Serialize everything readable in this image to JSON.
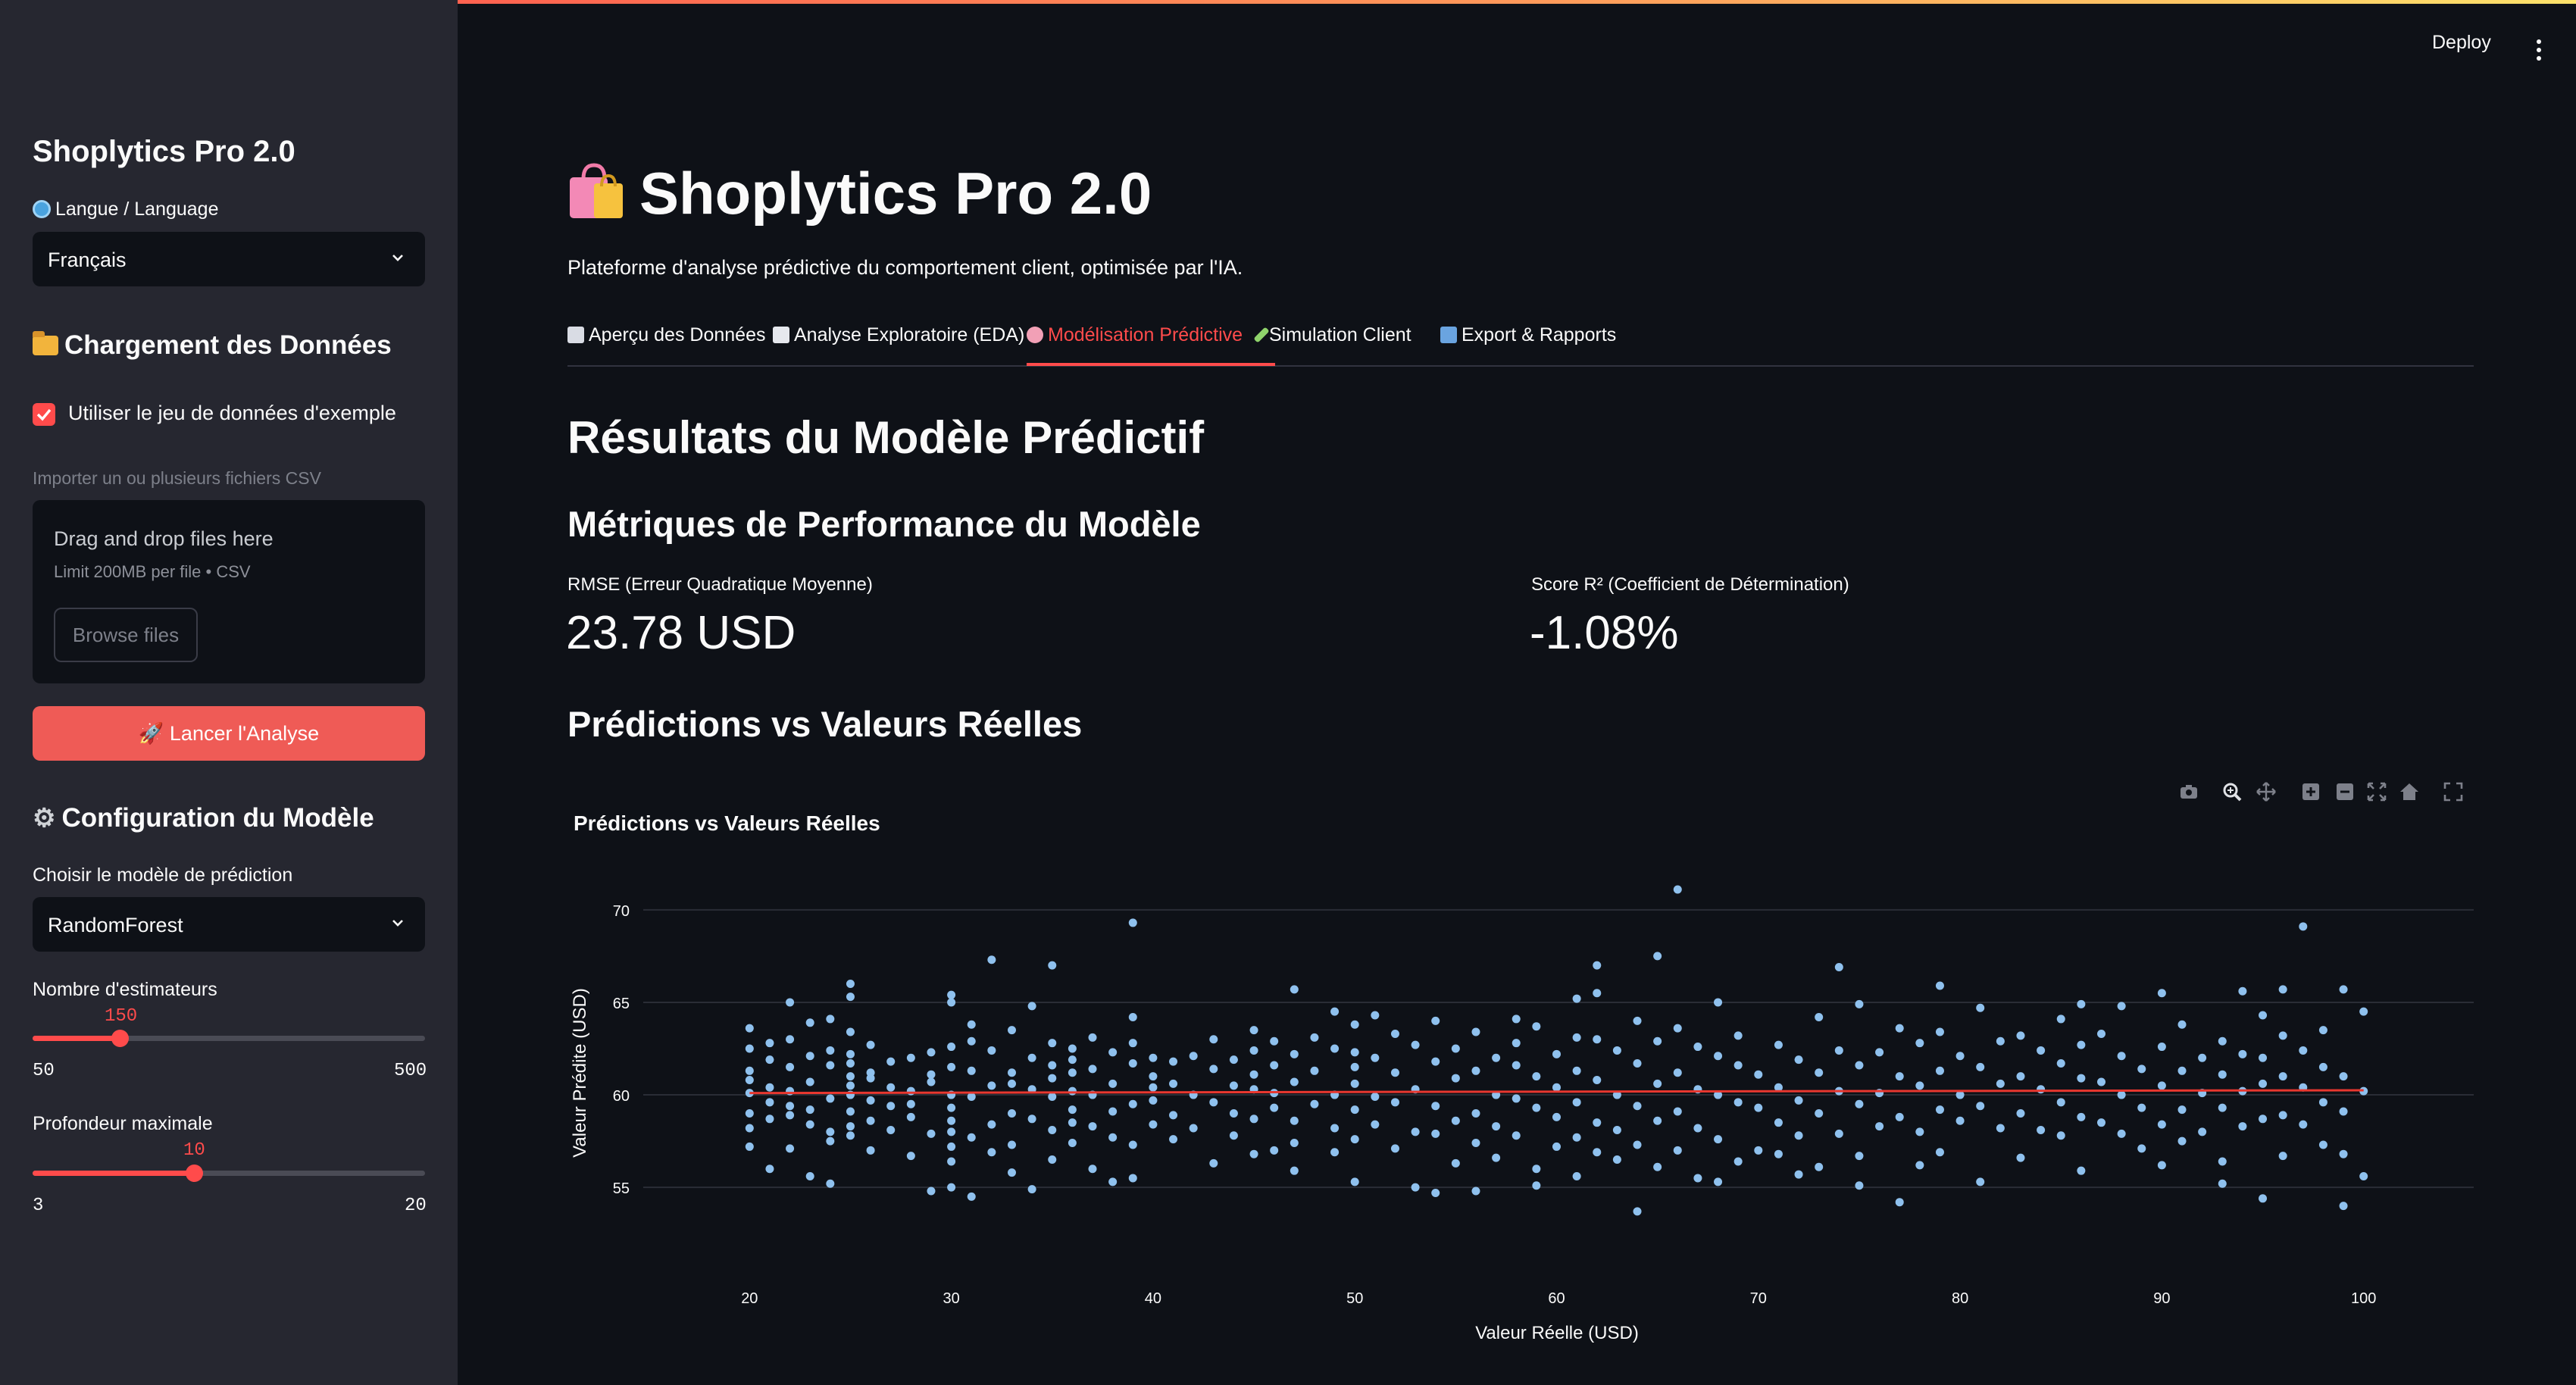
{
  "app": {
    "deploy_label": "Deploy"
  },
  "sidebar": {
    "title": "Shoplytics Pro 2.0",
    "language_label": "Langue / Language",
    "language_value": "Français",
    "data_section_title": "Chargement des Données",
    "use_example_label": "Utiliser le jeu de données d'exemple",
    "use_example_checked": true,
    "import_label": "Importer un ou plusieurs fichiers CSV",
    "uploader": {
      "drag_text": "Drag and drop files here",
      "limit_text": "Limit 200MB per file • CSV",
      "browse_label": "Browse files"
    },
    "launch_label": "🚀 Lancer l'Analyse",
    "model_section_title": "Configuration du Modèle",
    "model_choice_label": "Choisir le modèle de prédiction",
    "model_choice_value": "RandomForest",
    "estimators": {
      "label": "Nombre d'estimateurs",
      "value": "150",
      "min": "50",
      "max": "500",
      "fraction": 0.2222
    },
    "depth": {
      "label": "Profondeur maximale",
      "value": "10",
      "min": "3",
      "max": "20",
      "fraction": 0.4118
    }
  },
  "main": {
    "title": "Shoplytics Pro 2.0",
    "subtitle": "Plateforme d'analyse prédictive du comportement client, optimisée par l'IA.",
    "tabs": [
      {
        "label": "Aperçu des Données",
        "icon": "bar-chart-icon",
        "active": false
      },
      {
        "label": "Analyse Exploratoire (EDA)",
        "icon": "trend-chart-icon",
        "active": false
      },
      {
        "label": "Modélisation Prédictive",
        "icon": "brain-icon",
        "active": true
      },
      {
        "label": "Simulation Client",
        "icon": "syringe-icon",
        "active": false
      },
      {
        "label": "Export & Rapports",
        "icon": "outbox-tray-icon",
        "active": false
      }
    ],
    "results_title": "Résultats du Modèle Prédictif",
    "metrics_title": "Métriques de Performance du Modèle",
    "metrics": [
      {
        "label": "RMSE (Erreur Quadratique Moyenne)",
        "value": "23.78 USD"
      },
      {
        "label": "Score R² (Coefficient de Détermination)",
        "value": "-1.08%"
      }
    ],
    "pred_section_title": "Prédictions vs Valeurs Réelles"
  },
  "colors": {
    "accent": "#ff4b4b",
    "points": "#8fc1ee",
    "fit_line": "#e8372f",
    "background": "#0e1117",
    "sidebar": "#262730"
  },
  "chart_data": {
    "type": "scatter",
    "title": "Prédictions vs Valeurs Réelles",
    "xlabel": "Valeur Réelle (USD)",
    "ylabel": "Valeur Prédite (USD)",
    "xlim": [
      19.5,
      100.5
    ],
    "ylim": [
      53,
      72
    ],
    "x_ticks": [
      20,
      30,
      40,
      50,
      60,
      70,
      80,
      90,
      100
    ],
    "y_ticks": [
      55,
      60,
      65,
      70
    ],
    "grid": true,
    "legend": "none",
    "fit_line": {
      "x": [
        20,
        100
      ],
      "y": [
        60.1,
        60.25
      ]
    },
    "points": [
      [
        20,
        60.1
      ],
      [
        20,
        62.5
      ],
      [
        20,
        58.2
      ],
      [
        20,
        61.3
      ],
      [
        20,
        59.0
      ],
      [
        20,
        63.6
      ],
      [
        20,
        57.2
      ],
      [
        20,
        60.8
      ],
      [
        21,
        59.6
      ],
      [
        21,
        61.9
      ],
      [
        21,
        58.7
      ],
      [
        21,
        62.8
      ],
      [
        21,
        56.0
      ],
      [
        21,
        60.4
      ],
      [
        22,
        65.0
      ],
      [
        22,
        60.2
      ],
      [
        22,
        58.9
      ],
      [
        22,
        61.5
      ],
      [
        22,
        57.1
      ],
      [
        22,
        63.0
      ],
      [
        22,
        59.4
      ],
      [
        23,
        62.1
      ],
      [
        23,
        58.4
      ],
      [
        23,
        55.6
      ],
      [
        23,
        60.7
      ],
      [
        23,
        63.9
      ],
      [
        23,
        59.2
      ],
      [
        24,
        59.8
      ],
      [
        24,
        61.6
      ],
      [
        24,
        55.2
      ],
      [
        24,
        58.0
      ],
      [
        24,
        62.4
      ],
      [
        24,
        64.1
      ],
      [
        24,
        57.5
      ],
      [
        25,
        66.0
      ],
      [
        25,
        65.3
      ],
      [
        25,
        61.0
      ],
      [
        25,
        60.0
      ],
      [
        25,
        59.1
      ],
      [
        25,
        58.3
      ],
      [
        25,
        62.2
      ],
      [
        25,
        57.8
      ],
      [
        25,
        63.4
      ],
      [
        25,
        61.7
      ],
      [
        25,
        60.5
      ],
      [
        26,
        58.6
      ],
      [
        26,
        60.9
      ],
      [
        26,
        62.7
      ],
      [
        26,
        59.7
      ],
      [
        26,
        61.2
      ],
      [
        26,
        57.0
      ],
      [
        27,
        60.4
      ],
      [
        27,
        58.1
      ],
      [
        27,
        61.8
      ],
      [
        27,
        59.4
      ],
      [
        28,
        56.7
      ],
      [
        28,
        60.2
      ],
      [
        28,
        58.8
      ],
      [
        28,
        62.0
      ],
      [
        28,
        59.5
      ],
      [
        29,
        54.8
      ],
      [
        29,
        57.9
      ],
      [
        29,
        60.7
      ],
      [
        29,
        62.3
      ],
      [
        29,
        61.1
      ],
      [
        30,
        65.4
      ],
      [
        30,
        65.0
      ],
      [
        30,
        61.5
      ],
      [
        30,
        60.0
      ],
      [
        30,
        58.6
      ],
      [
        30,
        57.2
      ],
      [
        30,
        55.0
      ],
      [
        30,
        59.3
      ],
      [
        30,
        62.6
      ],
      [
        30,
        58.0
      ],
      [
        30,
        56.4
      ],
      [
        31,
        59.9
      ],
      [
        31,
        61.3
      ],
      [
        31,
        57.7
      ],
      [
        31,
        54.5
      ],
      [
        31,
        62.9
      ],
      [
        31,
        63.8
      ],
      [
        32,
        67.3
      ],
      [
        32,
        60.5
      ],
      [
        32,
        58.4
      ],
      [
        32,
        62.4
      ],
      [
        32,
        56.9
      ],
      [
        33,
        63.5
      ],
      [
        33,
        61.2
      ],
      [
        33,
        59.0
      ],
      [
        33,
        57.3
      ],
      [
        33,
        55.8
      ],
      [
        33,
        60.6
      ],
      [
        34,
        64.8
      ],
      [
        34,
        62.0
      ],
      [
        34,
        60.3
      ],
      [
        34,
        58.7
      ],
      [
        34,
        54.9
      ],
      [
        35,
        67.0
      ],
      [
        35,
        62.8
      ],
      [
        35,
        61.6
      ],
      [
        35,
        59.9
      ],
      [
        35,
        58.1
      ],
      [
        35,
        56.5
      ],
      [
        35,
        60.9
      ],
      [
        36,
        61.2
      ],
      [
        36,
        59.2
      ],
      [
        36,
        57.4
      ],
      [
        36,
        62.5
      ],
      [
        36,
        60.2
      ],
      [
        36,
        58.5
      ],
      [
        36,
        61.9
      ],
      [
        37,
        63.1
      ],
      [
        37,
        60.0
      ],
      [
        37,
        58.3
      ],
      [
        37,
        56.0
      ],
      [
        37,
        61.4
      ],
      [
        38,
        62.3
      ],
      [
        38,
        60.6
      ],
      [
        38,
        59.1
      ],
      [
        38,
        57.7
      ],
      [
        38,
        55.3
      ],
      [
        39,
        69.3
      ],
      [
        39,
        64.2
      ],
      [
        39,
        61.7
      ],
      [
        39,
        59.5
      ],
      [
        39,
        57.3
      ],
      [
        39,
        55.5
      ],
      [
        39,
        62.8
      ],
      [
        40,
        61.0
      ],
      [
        40,
        59.7
      ],
      [
        40,
        58.4
      ],
      [
        40,
        62.0
      ],
      [
        40,
        60.4
      ],
      [
        41,
        60.6
      ],
      [
        41,
        58.9
      ],
      [
        41,
        61.8
      ],
      [
        41,
        57.6
      ],
      [
        42,
        62.1
      ],
      [
        42,
        60.0
      ],
      [
        42,
        58.2
      ],
      [
        43,
        59.6
      ],
      [
        43,
        61.4
      ],
      [
        43,
        56.3
      ],
      [
        43,
        63.0
      ],
      [
        44,
        61.9
      ],
      [
        44,
        59.0
      ],
      [
        44,
        57.8
      ],
      [
        44,
        60.5
      ],
      [
        45,
        62.4
      ],
      [
        45,
        60.3
      ],
      [
        45,
        58.7
      ],
      [
        45,
        56.8
      ],
      [
        45,
        61.1
      ],
      [
        45,
        63.5
      ],
      [
        46,
        61.6
      ],
      [
        46,
        59.3
      ],
      [
        46,
        57.0
      ],
      [
        46,
        62.9
      ],
      [
        46,
        60.1
      ],
      [
        47,
        65.7
      ],
      [
        47,
        62.2
      ],
      [
        47,
        60.7
      ],
      [
        47,
        58.6
      ],
      [
        47,
        57.4
      ],
      [
        47,
        55.9
      ],
      [
        48,
        61.3
      ],
      [
        48,
        59.5
      ],
      [
        48,
        63.1
      ],
      [
        49,
        64.5
      ],
      [
        49,
        62.5
      ],
      [
        49,
        60.0
      ],
      [
        49,
        58.2
      ],
      [
        49,
        56.9
      ],
      [
        50,
        63.8
      ],
      [
        50,
        61.5
      ],
      [
        50,
        59.2
      ],
      [
        50,
        57.6
      ],
      [
        50,
        55.3
      ],
      [
        50,
        62.3
      ],
      [
        50,
        60.6
      ],
      [
        51,
        64.3
      ],
      [
        51,
        62.0
      ],
      [
        51,
        59.9
      ],
      [
        51,
        58.4
      ],
      [
        52,
        63.3
      ],
      [
        52,
        61.2
      ],
      [
        52,
        59.6
      ],
      [
        52,
        57.1
      ],
      [
        53,
        62.7
      ],
      [
        53,
        60.3
      ],
      [
        53,
        58.0
      ],
      [
        53,
        55.0
      ],
      [
        54,
        64.0
      ],
      [
        54,
        61.8
      ],
      [
        54,
        59.4
      ],
      [
        54,
        57.9
      ],
      [
        54,
        54.7
      ],
      [
        55,
        62.5
      ],
      [
        55,
        60.9
      ],
      [
        55,
        58.6
      ],
      [
        55,
        56.3
      ],
      [
        56,
        63.4
      ],
      [
        56,
        61.3
      ],
      [
        56,
        59.0
      ],
      [
        56,
        57.4
      ],
      [
        56,
        54.8
      ],
      [
        57,
        62.0
      ],
      [
        57,
        60.0
      ],
      [
        57,
        58.3
      ],
      [
        57,
        56.6
      ],
      [
        58,
        64.1
      ],
      [
        58,
        61.6
      ],
      [
        58,
        59.8
      ],
      [
        58,
        57.8
      ],
      [
        58,
        62.8
      ],
      [
        59,
        63.7
      ],
      [
        59,
        61.0
      ],
      [
        59,
        59.3
      ],
      [
        59,
        56.0
      ],
      [
        59,
        55.1
      ],
      [
        60,
        62.2
      ],
      [
        60,
        60.4
      ],
      [
        60,
        58.8
      ],
      [
        60,
        57.2
      ],
      [
        61,
        65.2
      ],
      [
        61,
        63.1
      ],
      [
        61,
        61.3
      ],
      [
        61,
        59.6
      ],
      [
        61,
        57.7
      ],
      [
        61,
        55.6
      ],
      [
        62,
        67.0
      ],
      [
        62,
        65.5
      ],
      [
        62,
        63.0
      ],
      [
        62,
        60.8
      ],
      [
        62,
        58.5
      ],
      [
        62,
        56.9
      ],
      [
        63,
        62.4
      ],
      [
        63,
        60.0
      ],
      [
        63,
        58.1
      ],
      [
        63,
        56.5
      ],
      [
        64,
        64.0
      ],
      [
        64,
        61.7
      ],
      [
        64,
        59.4
      ],
      [
        64,
        57.3
      ],
      [
        64,
        53.7
      ],
      [
        65,
        67.5
      ],
      [
        65,
        62.9
      ],
      [
        65,
        60.6
      ],
      [
        65,
        58.6
      ],
      [
        65,
        56.1
      ],
      [
        66,
        71.1
      ],
      [
        66,
        63.6
      ],
      [
        66,
        61.2
      ],
      [
        66,
        59.1
      ],
      [
        66,
        57.0
      ],
      [
        67,
        62.6
      ],
      [
        67,
        60.3
      ],
      [
        67,
        58.2
      ],
      [
        67,
        55.5
      ],
      [
        68,
        65.0
      ],
      [
        68,
        62.1
      ],
      [
        68,
        60.0
      ],
      [
        68,
        57.6
      ],
      [
        68,
        55.3
      ],
      [
        69,
        63.2
      ],
      [
        69,
        61.6
      ],
      [
        69,
        59.6
      ],
      [
        69,
        56.4
      ],
      [
        70,
        61.1
      ],
      [
        70,
        59.3
      ],
      [
        70,
        57.0
      ],
      [
        71,
        62.7
      ],
      [
        71,
        60.4
      ],
      [
        71,
        58.5
      ],
      [
        71,
        56.8
      ],
      [
        72,
        61.9
      ],
      [
        72,
        59.7
      ],
      [
        72,
        57.8
      ],
      [
        72,
        55.7
      ],
      [
        73,
        64.2
      ],
      [
        73,
        61.2
      ],
      [
        73,
        59.0
      ],
      [
        73,
        56.1
      ],
      [
        74,
        66.9
      ],
      [
        74,
        62.4
      ],
      [
        74,
        60.2
      ],
      [
        74,
        57.9
      ],
      [
        75,
        64.9
      ],
      [
        75,
        61.6
      ],
      [
        75,
        59.5
      ],
      [
        75,
        56.7
      ],
      [
        75,
        55.1
      ],
      [
        76,
        62.3
      ],
      [
        76,
        60.1
      ],
      [
        76,
        58.3
      ],
      [
        77,
        63.6
      ],
      [
        77,
        61.0
      ],
      [
        77,
        58.8
      ],
      [
        77,
        54.2
      ],
      [
        78,
        62.8
      ],
      [
        78,
        60.5
      ],
      [
        78,
        58.0
      ],
      [
        78,
        56.2
      ],
      [
        79,
        65.9
      ],
      [
        79,
        63.4
      ],
      [
        79,
        61.3
      ],
      [
        79,
        59.2
      ],
      [
        79,
        56.9
      ],
      [
        80,
        62.1
      ],
      [
        80,
        60.0
      ],
      [
        80,
        58.6
      ],
      [
        81,
        64.7
      ],
      [
        81,
        61.5
      ],
      [
        81,
        59.4
      ],
      [
        81,
        55.3
      ],
      [
        82,
        62.9
      ],
      [
        82,
        60.6
      ],
      [
        82,
        58.2
      ],
      [
        83,
        63.2
      ],
      [
        83,
        61.0
      ],
      [
        83,
        59.0
      ],
      [
        83,
        56.6
      ],
      [
        84,
        62.4
      ],
      [
        84,
        60.3
      ],
      [
        84,
        58.1
      ],
      [
        85,
        64.1
      ],
      [
        85,
        61.7
      ],
      [
        85,
        59.6
      ],
      [
        85,
        57.8
      ],
      [
        86,
        64.9
      ],
      [
        86,
        62.7
      ],
      [
        86,
        60.9
      ],
      [
        86,
        58.8
      ],
      [
        86,
        55.9
      ],
      [
        87,
        63.3
      ],
      [
        87,
        60.7
      ],
      [
        87,
        58.5
      ],
      [
        88,
        64.8
      ],
      [
        88,
        62.1
      ],
      [
        88,
        60.0
      ],
      [
        88,
        57.9
      ],
      [
        89,
        61.4
      ],
      [
        89,
        59.3
      ],
      [
        89,
        57.1
      ],
      [
        90,
        65.5
      ],
      [
        90,
        62.6
      ],
      [
        90,
        60.5
      ],
      [
        90,
        58.4
      ],
      [
        90,
        56.2
      ],
      [
        91,
        63.8
      ],
      [
        91,
        61.3
      ],
      [
        91,
        59.2
      ],
      [
        91,
        57.5
      ],
      [
        92,
        62.0
      ],
      [
        92,
        60.1
      ],
      [
        92,
        58.0
      ],
      [
        93,
        62.9
      ],
      [
        93,
        61.1
      ],
      [
        93,
        59.3
      ],
      [
        93,
        56.4
      ],
      [
        93,
        55.2
      ],
      [
        94,
        65.6
      ],
      [
        94,
        62.2
      ],
      [
        94,
        60.2
      ],
      [
        94,
        58.3
      ],
      [
        95,
        64.3
      ],
      [
        95,
        62.0
      ],
      [
        95,
        60.6
      ],
      [
        95,
        58.7
      ],
      [
        95,
        54.4
      ],
      [
        96,
        65.7
      ],
      [
        96,
        63.2
      ],
      [
        96,
        61.0
      ],
      [
        96,
        58.9
      ],
      [
        96,
        56.7
      ],
      [
        97,
        69.1
      ],
      [
        97,
        62.4
      ],
      [
        97,
        60.4
      ],
      [
        97,
        58.4
      ],
      [
        98,
        63.5
      ],
      [
        98,
        61.5
      ],
      [
        98,
        59.6
      ],
      [
        98,
        57.3
      ],
      [
        99,
        65.7
      ],
      [
        99,
        61.0
      ],
      [
        99,
        59.1
      ],
      [
        99,
        56.8
      ],
      [
        99,
        54.0
      ],
      [
        100,
        64.5
      ],
      [
        100,
        60.2
      ],
      [
        100,
        55.6
      ]
    ]
  }
}
